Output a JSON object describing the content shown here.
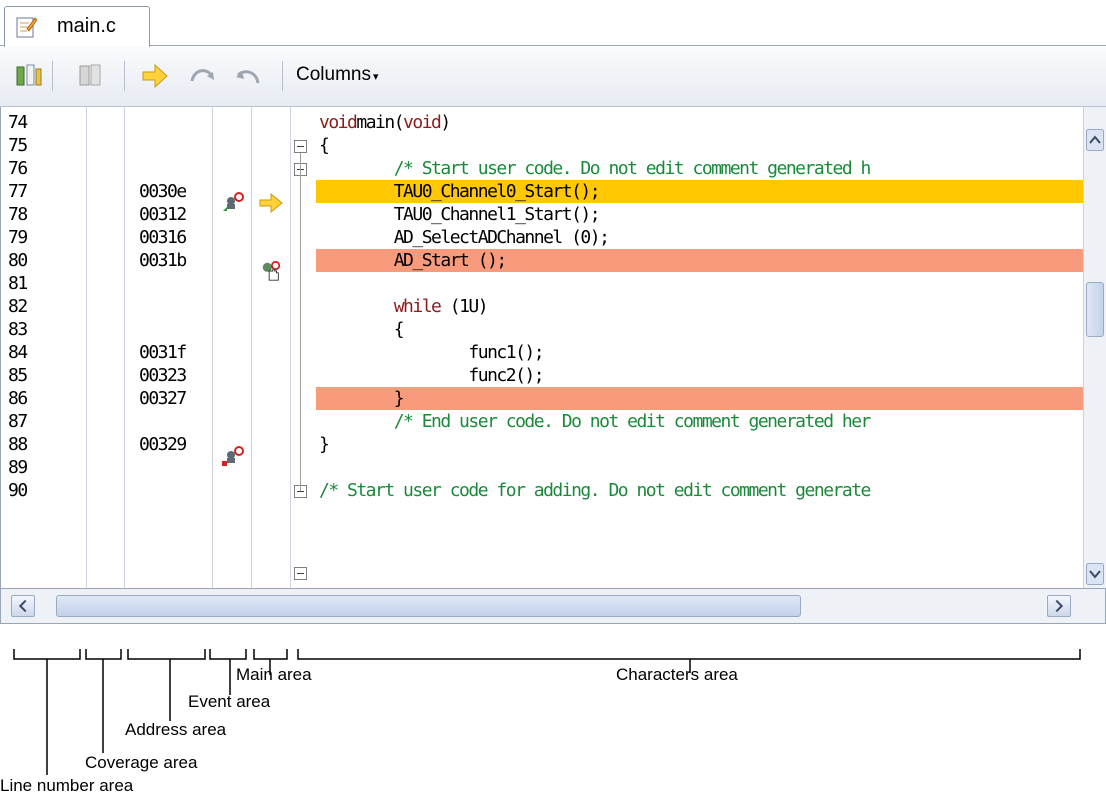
{
  "tab": {
    "label": "main.c",
    "icon": "c-source-file-icon"
  },
  "toolbar": {
    "buttons": [
      "sync-editor-icon",
      "sync-disabled-icon",
      "show-current-pc-icon",
      "step-over-icon",
      "undo-icon"
    ],
    "columns_label": "Columns",
    "columns_caret": "▾"
  },
  "editor": {
    "lines": [
      {
        "ln": "74",
        "addr": "",
        "code": [
          [
            "kw",
            "void"
          ],
          [
            "",
            "main("
          ],
          [
            "kw",
            "void"
          ],
          [
            "",
            ")"
          ]
        ]
      },
      {
        "ln": "75",
        "addr": "",
        "code": [
          [
            "",
            "{"
          ]
        ]
      },
      {
        "ln": "76",
        "addr": "",
        "code": [
          [
            "cm",
            "        /* Start user code. Do not edit comment generated h"
          ]
        ]
      },
      {
        "ln": "77",
        "addr": "0030e",
        "code": [
          [
            "",
            "        TAU0_Channel0_Start();"
          ]
        ],
        "highlight": "#ffc800"
      },
      {
        "ln": "78",
        "addr": "00312",
        "code": [
          [
            "",
            "        TAU0_Channel1_Start();"
          ]
        ]
      },
      {
        "ln": "79",
        "addr": "00316",
        "code": [
          [
            "",
            "        AD_SelectADChannel (0);"
          ]
        ]
      },
      {
        "ln": "80",
        "addr": "0031b",
        "code": [
          [
            "",
            "        AD_Start ();"
          ]
        ],
        "highlight": "#f89a7c"
      },
      {
        "ln": "81",
        "addr": "",
        "code": []
      },
      {
        "ln": "82",
        "addr": "",
        "code": [
          [
            "",
            "        "
          ],
          [
            "kw",
            "while"
          ],
          [
            "",
            " (1U)"
          ]
        ]
      },
      {
        "ln": "83",
        "addr": "",
        "code": [
          [
            "",
            "        {"
          ]
        ]
      },
      {
        "ln": "84",
        "addr": "0031f",
        "code": [
          [
            "",
            "                func1();"
          ]
        ]
      },
      {
        "ln": "85",
        "addr": "00323",
        "code": [
          [
            "",
            "                func2();"
          ]
        ]
      },
      {
        "ln": "86",
        "addr": "00327",
        "code": [
          [
            "",
            "        }"
          ]
        ],
        "highlight": "#f89a7c"
      },
      {
        "ln": "87",
        "addr": "",
        "code": [
          [
            "cm",
            "        /* End user code. Do not edit comment generated her"
          ]
        ]
      },
      {
        "ln": "88",
        "addr": "00329",
        "code": [
          [
            "",
            "}"
          ]
        ]
      },
      {
        "ln": "89",
        "addr": "",
        "code": []
      },
      {
        "ln": "90",
        "addr": "",
        "code": [
          [
            "cm",
            "/* Start user code for adding. Do not edit comment generate"
          ]
        ]
      }
    ]
  },
  "annotations": {
    "line_number_area": "Line number area",
    "coverage_area": "Coverage area",
    "address_area": "Address area",
    "event_area": "Event area",
    "main_area": "Main area",
    "characters_area": "Characters area"
  },
  "colors": {
    "current_line": "#ffc800",
    "breakpoint_line": "#f89a7c",
    "keyword": "#8b1a1a",
    "comment": "#1a8a3a"
  }
}
